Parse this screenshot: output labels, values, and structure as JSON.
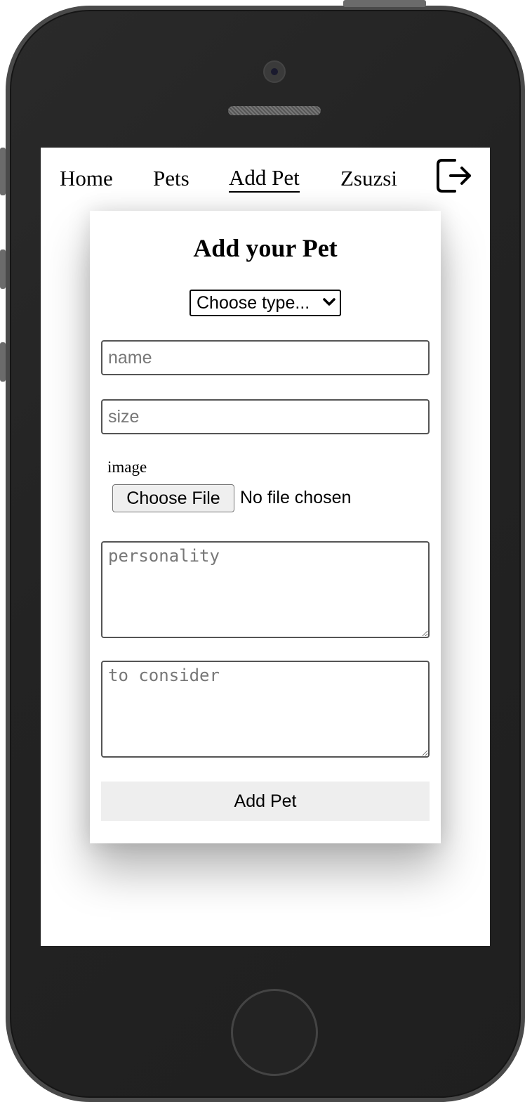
{
  "nav": {
    "items": [
      {
        "label": "Home"
      },
      {
        "label": "Pets"
      },
      {
        "label": "Add Pet",
        "active": true
      },
      {
        "label": "Zsuzsi"
      }
    ],
    "logout_icon": "logout-icon"
  },
  "form": {
    "title": "Add your Pet",
    "type_select": {
      "selected": "Choose type..."
    },
    "name_placeholder": "name",
    "size_placeholder": "size",
    "image_label": "image",
    "file_button_label": "Choose File",
    "file_status": "No file chosen",
    "personality_placeholder": "personality",
    "consider_placeholder": "to consider",
    "submit_label": "Add Pet"
  }
}
